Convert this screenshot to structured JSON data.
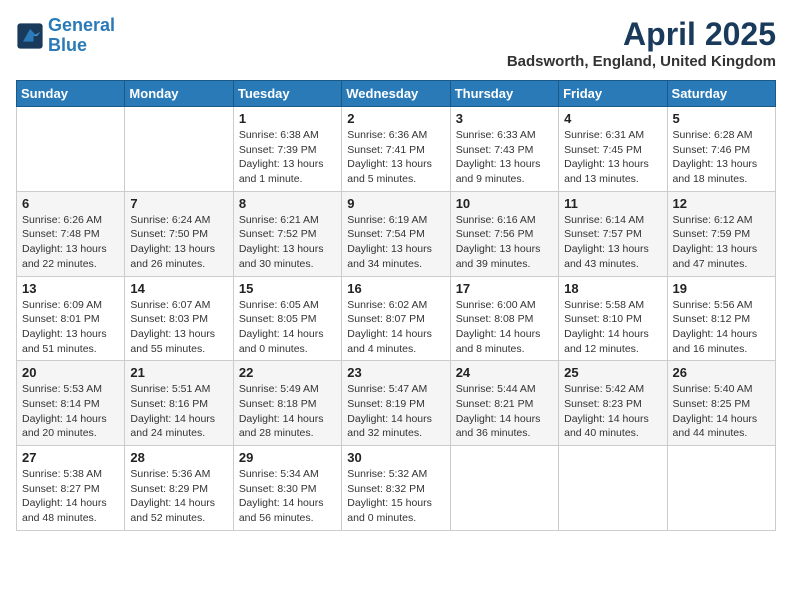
{
  "header": {
    "logo_line1": "General",
    "logo_line2": "Blue",
    "month_year": "April 2025",
    "location": "Badsworth, England, United Kingdom"
  },
  "weekdays": [
    "Sunday",
    "Monday",
    "Tuesday",
    "Wednesday",
    "Thursday",
    "Friday",
    "Saturday"
  ],
  "weeks": [
    [
      {
        "day": "",
        "text": ""
      },
      {
        "day": "",
        "text": ""
      },
      {
        "day": "1",
        "text": "Sunrise: 6:38 AM\nSunset: 7:39 PM\nDaylight: 13 hours and 1 minute."
      },
      {
        "day": "2",
        "text": "Sunrise: 6:36 AM\nSunset: 7:41 PM\nDaylight: 13 hours and 5 minutes."
      },
      {
        "day": "3",
        "text": "Sunrise: 6:33 AM\nSunset: 7:43 PM\nDaylight: 13 hours and 9 minutes."
      },
      {
        "day": "4",
        "text": "Sunrise: 6:31 AM\nSunset: 7:45 PM\nDaylight: 13 hours and 13 minutes."
      },
      {
        "day": "5",
        "text": "Sunrise: 6:28 AM\nSunset: 7:46 PM\nDaylight: 13 hours and 18 minutes."
      }
    ],
    [
      {
        "day": "6",
        "text": "Sunrise: 6:26 AM\nSunset: 7:48 PM\nDaylight: 13 hours and 22 minutes."
      },
      {
        "day": "7",
        "text": "Sunrise: 6:24 AM\nSunset: 7:50 PM\nDaylight: 13 hours and 26 minutes."
      },
      {
        "day": "8",
        "text": "Sunrise: 6:21 AM\nSunset: 7:52 PM\nDaylight: 13 hours and 30 minutes."
      },
      {
        "day": "9",
        "text": "Sunrise: 6:19 AM\nSunset: 7:54 PM\nDaylight: 13 hours and 34 minutes."
      },
      {
        "day": "10",
        "text": "Sunrise: 6:16 AM\nSunset: 7:56 PM\nDaylight: 13 hours and 39 minutes."
      },
      {
        "day": "11",
        "text": "Sunrise: 6:14 AM\nSunset: 7:57 PM\nDaylight: 13 hours and 43 minutes."
      },
      {
        "day": "12",
        "text": "Sunrise: 6:12 AM\nSunset: 7:59 PM\nDaylight: 13 hours and 47 minutes."
      }
    ],
    [
      {
        "day": "13",
        "text": "Sunrise: 6:09 AM\nSunset: 8:01 PM\nDaylight: 13 hours and 51 minutes."
      },
      {
        "day": "14",
        "text": "Sunrise: 6:07 AM\nSunset: 8:03 PM\nDaylight: 13 hours and 55 minutes."
      },
      {
        "day": "15",
        "text": "Sunrise: 6:05 AM\nSunset: 8:05 PM\nDaylight: 14 hours and 0 minutes."
      },
      {
        "day": "16",
        "text": "Sunrise: 6:02 AM\nSunset: 8:07 PM\nDaylight: 14 hours and 4 minutes."
      },
      {
        "day": "17",
        "text": "Sunrise: 6:00 AM\nSunset: 8:08 PM\nDaylight: 14 hours and 8 minutes."
      },
      {
        "day": "18",
        "text": "Sunrise: 5:58 AM\nSunset: 8:10 PM\nDaylight: 14 hours and 12 minutes."
      },
      {
        "day": "19",
        "text": "Sunrise: 5:56 AM\nSunset: 8:12 PM\nDaylight: 14 hours and 16 minutes."
      }
    ],
    [
      {
        "day": "20",
        "text": "Sunrise: 5:53 AM\nSunset: 8:14 PM\nDaylight: 14 hours and 20 minutes."
      },
      {
        "day": "21",
        "text": "Sunrise: 5:51 AM\nSunset: 8:16 PM\nDaylight: 14 hours and 24 minutes."
      },
      {
        "day": "22",
        "text": "Sunrise: 5:49 AM\nSunset: 8:18 PM\nDaylight: 14 hours and 28 minutes."
      },
      {
        "day": "23",
        "text": "Sunrise: 5:47 AM\nSunset: 8:19 PM\nDaylight: 14 hours and 32 minutes."
      },
      {
        "day": "24",
        "text": "Sunrise: 5:44 AM\nSunset: 8:21 PM\nDaylight: 14 hours and 36 minutes."
      },
      {
        "day": "25",
        "text": "Sunrise: 5:42 AM\nSunset: 8:23 PM\nDaylight: 14 hours and 40 minutes."
      },
      {
        "day": "26",
        "text": "Sunrise: 5:40 AM\nSunset: 8:25 PM\nDaylight: 14 hours and 44 minutes."
      }
    ],
    [
      {
        "day": "27",
        "text": "Sunrise: 5:38 AM\nSunset: 8:27 PM\nDaylight: 14 hours and 48 minutes."
      },
      {
        "day": "28",
        "text": "Sunrise: 5:36 AM\nSunset: 8:29 PM\nDaylight: 14 hours and 52 minutes."
      },
      {
        "day": "29",
        "text": "Sunrise: 5:34 AM\nSunset: 8:30 PM\nDaylight: 14 hours and 56 minutes."
      },
      {
        "day": "30",
        "text": "Sunrise: 5:32 AM\nSunset: 8:32 PM\nDaylight: 15 hours and 0 minutes."
      },
      {
        "day": "",
        "text": ""
      },
      {
        "day": "",
        "text": ""
      },
      {
        "day": "",
        "text": ""
      }
    ]
  ]
}
